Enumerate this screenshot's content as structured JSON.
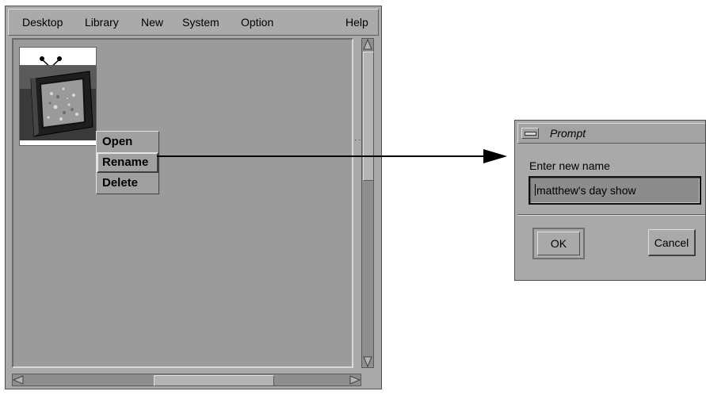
{
  "main_window": {
    "menu": [
      "Desktop",
      "Library",
      "New",
      "System",
      "Option"
    ],
    "help_label": "Help",
    "desktop_item_name": "tv-icon",
    "context_menu": {
      "items": [
        "Open",
        "Rename",
        "Delete"
      ],
      "selected": "Rename"
    }
  },
  "prompt_dialog": {
    "title": "Prompt",
    "label": "Enter new name",
    "input_value": "matthew's day show",
    "ok_label": "OK",
    "cancel_label": "Cancel"
  }
}
